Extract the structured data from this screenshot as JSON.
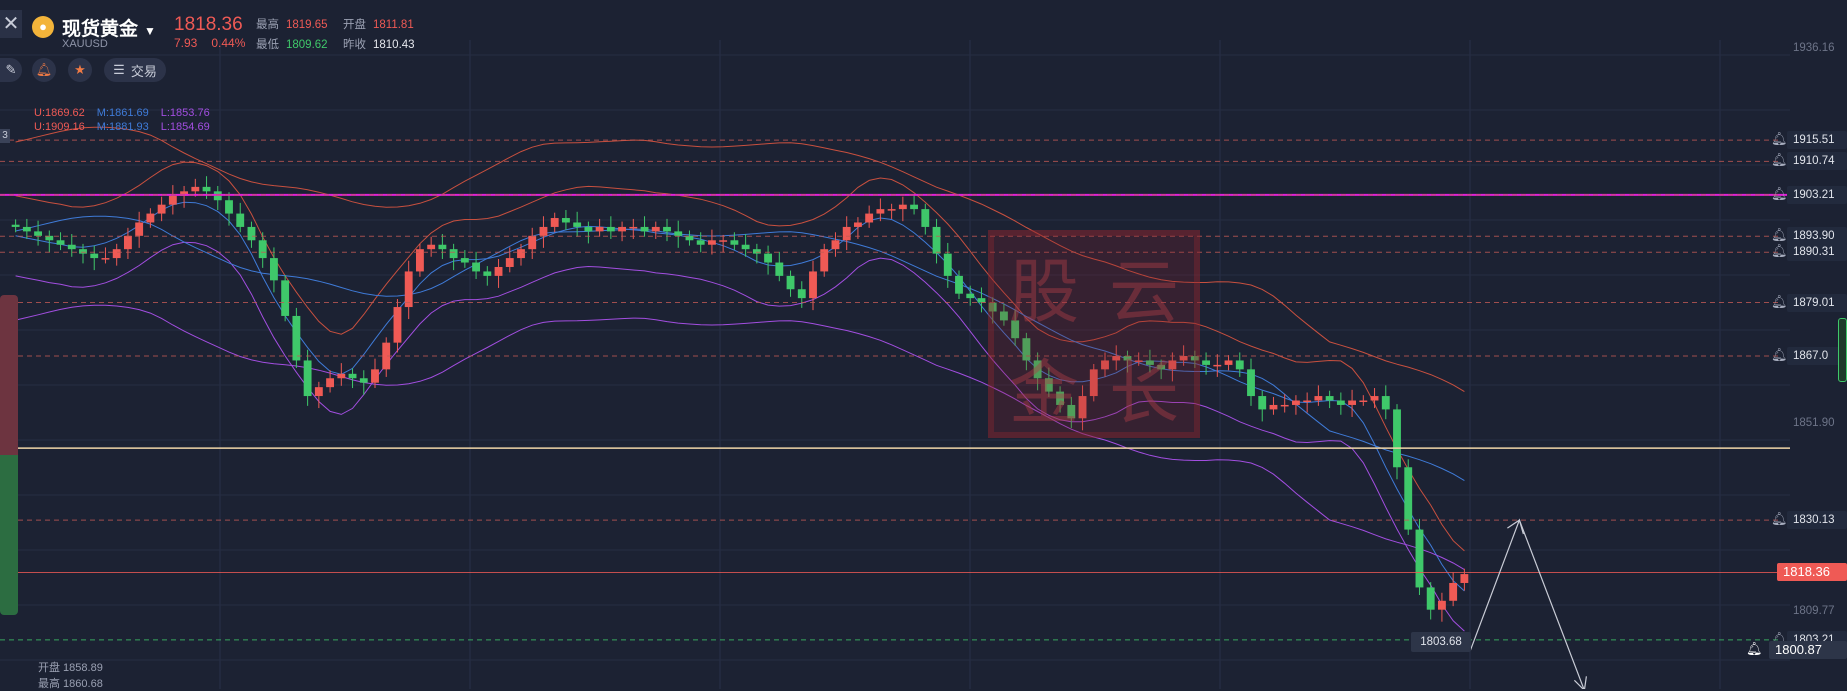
{
  "header": {
    "close_icon": "close-icon",
    "coin_icon": "gold-coin-icon",
    "instrument_name": "现货黄金",
    "symbol": "XAUUSD",
    "last_price": "1818.36",
    "change_abs": "7.93",
    "change_pct": "0.44%",
    "stats": {
      "high_label": "最高",
      "high": "1819.65",
      "open_label": "开盘",
      "open": "1811.81",
      "low_label": "最低",
      "low": "1809.62",
      "prev_close_label": "昨收",
      "prev_close": "1810.43"
    }
  },
  "toolbar": {
    "draw_icon": "pencil-icon",
    "alert_icon": "bell-icon",
    "favorite_icon": "star-icon",
    "trade_icon": "menu-icon",
    "trade_label": "交易"
  },
  "indicator_legend": {
    "row1": [
      "U:1869.62",
      "M:1861.69",
      "L:1853.76"
    ],
    "row2": [
      "U:1909.16",
      "M:1881.93",
      "L:1854.69"
    ],
    "left_marker": "3"
  },
  "watermark_chars": [
    "股",
    "云",
    "金",
    "长"
  ],
  "bottom_info": {
    "open_label": "开盘 1858.89",
    "high_label": "最高 1860.68"
  },
  "low_marker": "1803.68",
  "colors": {
    "background": "#1c2233",
    "up": "#ef5a55",
    "down": "#3fc86a",
    "band_outer": "#c8503f",
    "band_mid": "#3f7bd8",
    "band_purple": "#a24ee0",
    "resistance": "#e020d8",
    "support": "#f0d6a8"
  },
  "price_axis": {
    "gridline_labels": [
      "1936.16",
      "1851.90",
      "1809.77"
    ],
    "alert_levels": [
      {
        "value": "1915.51"
      },
      {
        "value": "1910.74"
      },
      {
        "value": "1903.21"
      },
      {
        "value": "1893.90"
      },
      {
        "value": "1890.31"
      },
      {
        "value": "1879.01"
      },
      {
        "value": "1867.0"
      },
      {
        "value": "1830.13"
      },
      {
        "value": "1803.21"
      }
    ],
    "current": "1818.36",
    "crosshair": "1800.87"
  },
  "chart_data": {
    "type": "candlestick",
    "ylim": [
      1796,
      1938
    ],
    "horizontal_levels": {
      "resistance_magenta": 1903.21,
      "support_beige": 1846.3
    },
    "close_path": [
      1896,
      1895,
      1894,
      1893,
      1892,
      1891,
      1890,
      1889,
      1889,
      1891,
      1894,
      1897,
      1899,
      1901,
      1903,
      1904,
      1905,
      1904,
      1902,
      1899,
      1896,
      1893,
      1889,
      1884,
      1876,
      1866,
      1858,
      1860,
      1862,
      1863,
      1862,
      1861,
      1864,
      1870,
      1878,
      1886,
      1891,
      1892,
      1891,
      1889,
      1888,
      1886,
      1885,
      1887,
      1889,
      1891,
      1894,
      1896,
      1898,
      1897,
      1896,
      1895,
      1896,
      1895,
      1896,
      1896,
      1895,
      1896,
      1895,
      1894,
      1893,
      1892,
      1893,
      1893,
      1892,
      1891,
      1890,
      1888,
      1885,
      1882,
      1880,
      1886,
      1891,
      1893,
      1896,
      1897,
      1899,
      1900,
      1900,
      1901,
      1900,
      1896,
      1890,
      1885,
      1881,
      1880,
      1879,
      1877,
      1875,
      1871,
      1866,
      1862,
      1859,
      1856,
      1853,
      1858,
      1864,
      1866,
      1867,
      1866,
      1866,
      1865,
      1864,
      1866,
      1867,
      1866,
      1865,
      1865,
      1866,
      1864,
      1858,
      1855,
      1856,
      1856,
      1857,
      1857,
      1858,
      1857,
      1856,
      1857,
      1857,
      1858,
      1855,
      1842,
      1828,
      1815,
      1810,
      1812,
      1816,
      1818
    ],
    "projection": [
      [
        1830.13,
        "up"
      ],
      [
        1800.87,
        "down"
      ]
    ]
  }
}
